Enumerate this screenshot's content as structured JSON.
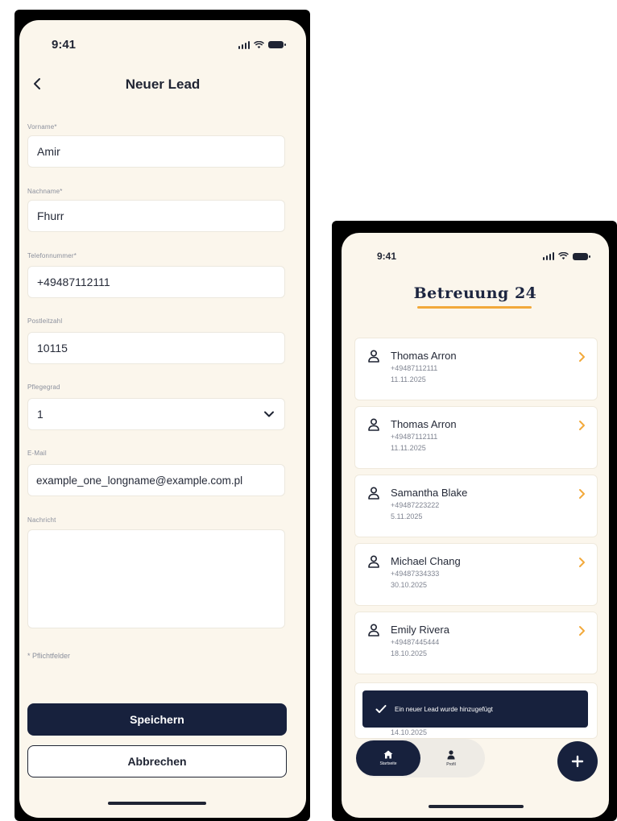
{
  "left": {
    "status": {
      "time": "9:41"
    },
    "nav": {
      "title": "Neuer Lead"
    },
    "fields": {
      "first_name": {
        "label": "Vorname*",
        "value": "Amir"
      },
      "last_name": {
        "label": "Nachname*",
        "value": "Fhurr"
      },
      "phone": {
        "label": "Telefonnummer*",
        "value": "+49487112111"
      },
      "zip": {
        "label": "Postleitzahl",
        "value": "10115"
      },
      "care_level": {
        "label": "Pflegegrad",
        "value": "1"
      },
      "email": {
        "label": "E-Mail",
        "value": "example_one_longname@example.com.pl"
      },
      "message": {
        "label": "Nachricht",
        "value": ""
      }
    },
    "required_hint": "* Pflichtfelder",
    "buttons": {
      "save": "Speichern",
      "cancel": "Abbrechen"
    }
  },
  "right": {
    "status": {
      "time": "9:41"
    },
    "brand": {
      "title": "Betreuung 24",
      "accent": "#f2a93b"
    },
    "leads": [
      {
        "name": "Thomas Arron",
        "phone": "+49487112111",
        "date": "11.11.2025"
      },
      {
        "name": "Thomas Arron",
        "phone": "+49487112111",
        "date": "11.11.2025"
      },
      {
        "name": "Samantha Blake",
        "phone": "+49487223222",
        "date": "5.11.2025"
      },
      {
        "name": "Michael Chang",
        "phone": "+49487334333",
        "date": "30.10.2025"
      },
      {
        "name": "Emily Rivera",
        "phone": "+49487445444",
        "date": "18.10.2025"
      }
    ],
    "peek_date": "14.10.2025",
    "toast": {
      "message": "Ein neuer Lead wurde hinzugefügt"
    },
    "tabs": {
      "home": "Startseite",
      "profile": "Profil"
    }
  },
  "colors": {
    "primary": "#17213d",
    "background": "#fbf6ec",
    "chevron": "#f2a93b"
  }
}
